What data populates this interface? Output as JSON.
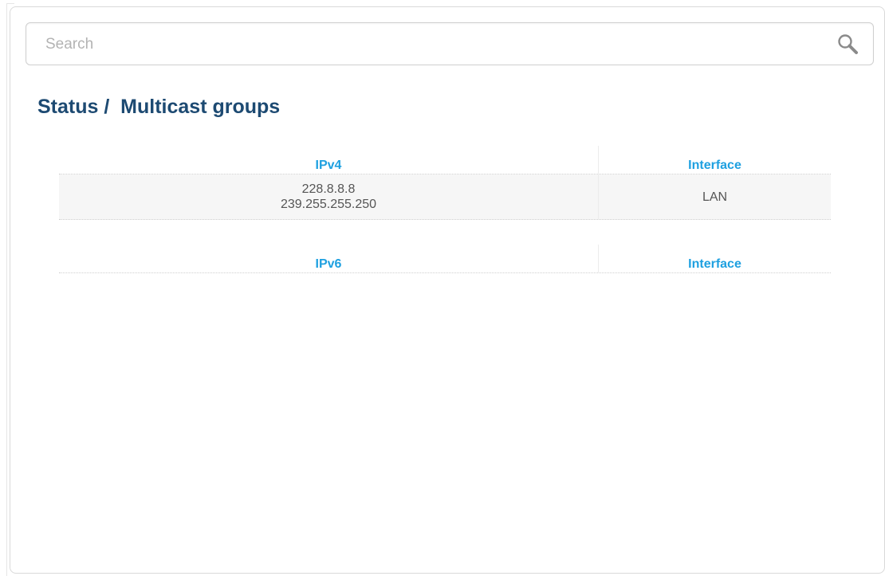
{
  "search": {
    "placeholder": "Search"
  },
  "page": {
    "title": "Status /  Multicast groups"
  },
  "ipv4_table": {
    "headers": [
      "IPv4",
      "Interface"
    ],
    "rows": [
      {
        "addresses": [
          "228.8.8.8",
          "239.255.255.250"
        ],
        "interface": "LAN"
      }
    ]
  },
  "ipv6_table": {
    "headers": [
      "IPv6",
      "Interface"
    ],
    "rows": []
  },
  "colors": {
    "title": "#1d4a72",
    "header_accent": "#1ea0e0",
    "row_background": "#f6f6f6"
  },
  "icons": {
    "search": "search-icon"
  }
}
